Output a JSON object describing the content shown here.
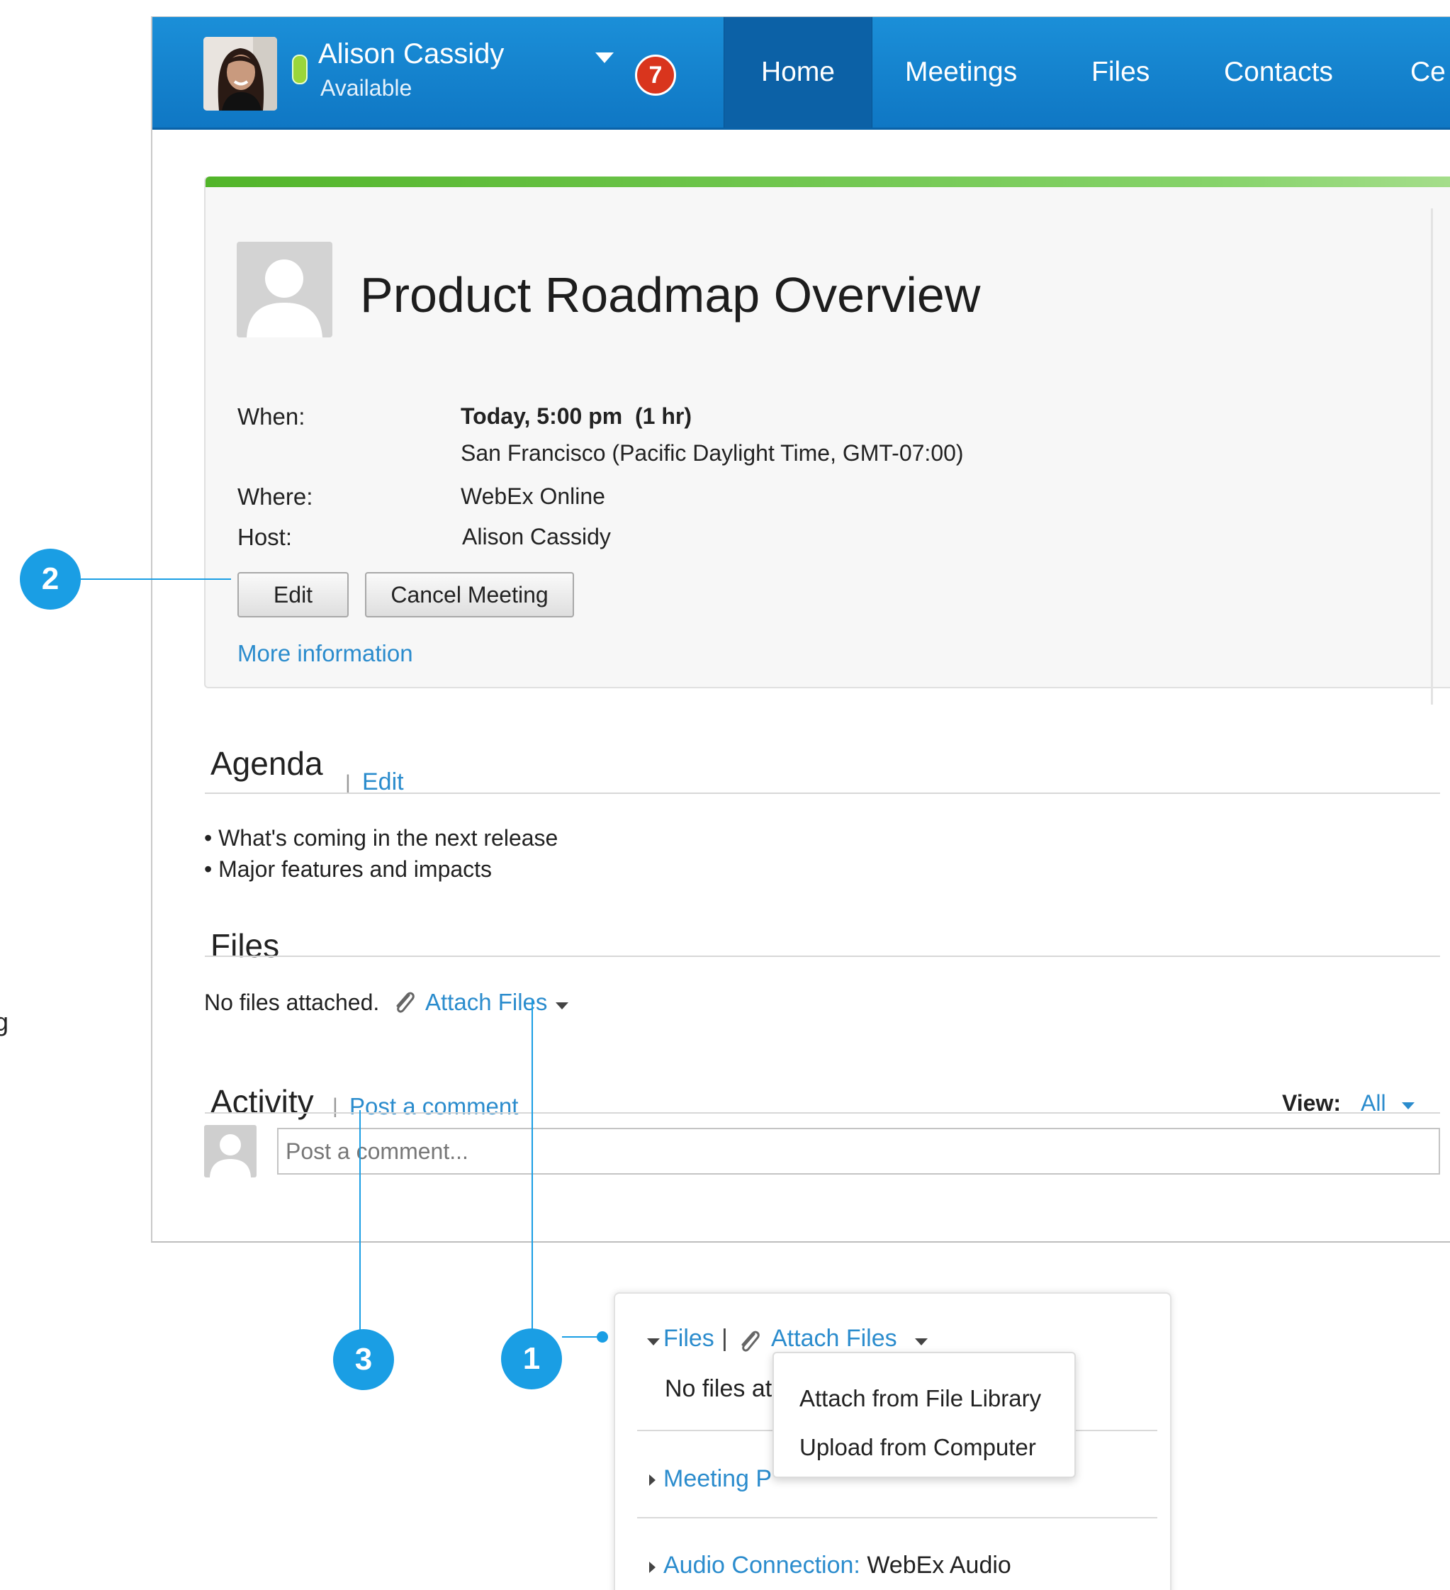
{
  "user": {
    "name": "Alison Cassidy",
    "status": "Available",
    "notifications": "7"
  },
  "nav": {
    "tabs": [
      "Home",
      "Meetings",
      "Files",
      "Contacts",
      "Ce"
    ]
  },
  "meeting": {
    "title": "Product Roadmap Overview",
    "when_label": "When:",
    "when_value": "Today, 5:00 pm  (1 hr)",
    "timezone": "San Francisco (Pacific Daylight Time, GMT-07:00)",
    "where_label": "Where:",
    "where_value": "WebEx Online",
    "host_label": "Host:",
    "host_value": "Alison Cassidy",
    "edit_button": "Edit",
    "cancel_button": "Cancel Meeting",
    "more_info": "More information"
  },
  "agenda": {
    "title": "Agenda",
    "separator": "|",
    "edit_link": "Edit",
    "items": [
      "• What's coming in the next release",
      "• Major features and impacts"
    ]
  },
  "files": {
    "title": "Files",
    "empty_text": "No files attached.",
    "attach_link": "Attach Files"
  },
  "activity": {
    "title": "Activity",
    "separator": "|",
    "post_link": "Post a comment",
    "view_label": "View:",
    "view_value": "All",
    "comment_placeholder": "Post a comment..."
  },
  "callouts": [
    "1",
    "2",
    "3"
  ],
  "edge_fragment": "g",
  "inset": {
    "files_link": "Files",
    "separator": "|",
    "attach_link": "Attach Files",
    "no_files_text": "No files at",
    "meeting_link": "Meeting P",
    "audio_label": "Audio Connection:",
    "audio_value": " WebEx Audio",
    "menu_items": [
      "Attach from File Library",
      "Upload from Computer"
    ]
  },
  "colors": {
    "nav_blue": "#1487d3",
    "active_tab": "#0c61a6",
    "link": "#2b8ccd",
    "accent_green": "#52b52a",
    "callout": "#1a9ee4",
    "badge_red": "#d9351d"
  }
}
